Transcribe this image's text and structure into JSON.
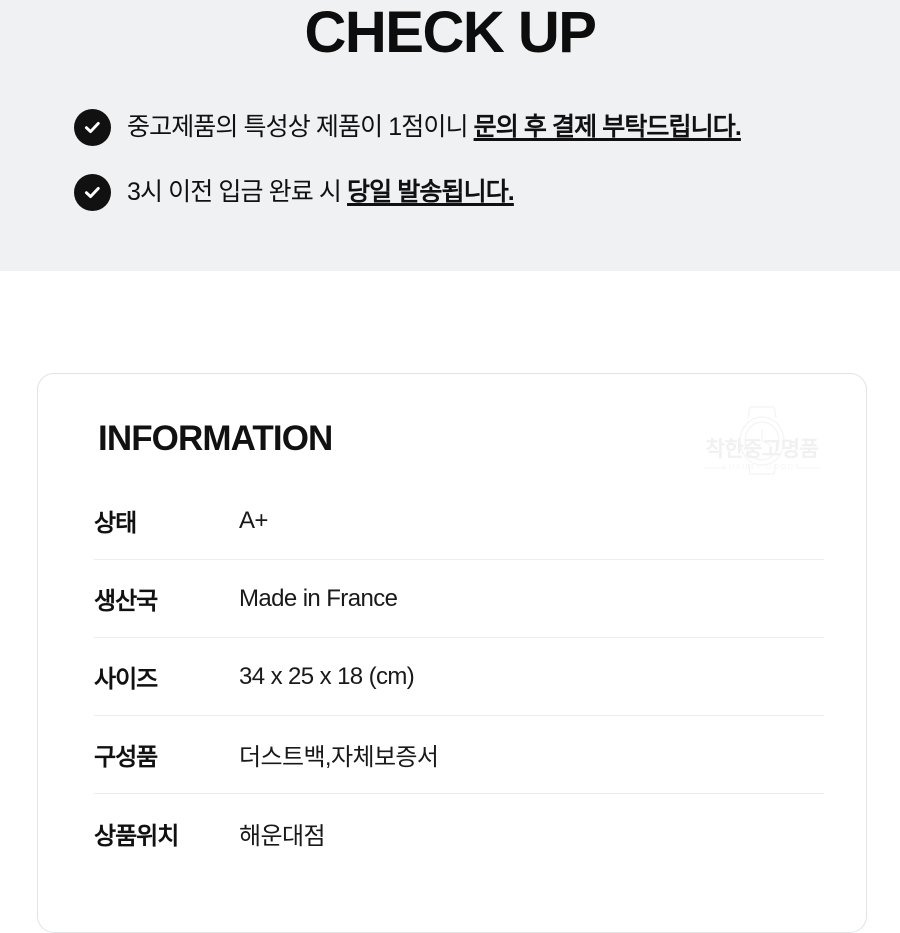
{
  "checkup": {
    "title": "CHECK UP",
    "items": [
      {
        "icon": "check-circle-icon",
        "plain": "중고제품의 특성상 제품이 1점이니 ",
        "emphasis": "문의 후 결제 부탁드립니다."
      },
      {
        "icon": "check-circle-icon",
        "plain": "3시 이전 입금 완료 시 ",
        "emphasis": "당일 발송됩니다."
      }
    ]
  },
  "info_card": {
    "heading": "INFORMATION",
    "watermark": {
      "icon": "watch-outline-icon",
      "brand": "착한중고명품",
      "tagline": "LUXURY GOODS"
    },
    "rows": [
      {
        "label": "상태",
        "value": "A+"
      },
      {
        "label": "생산국",
        "value": "Made in France"
      },
      {
        "label": "사이즈",
        "value": "34 x 25 x 18 (cm)"
      },
      {
        "label": "구성품",
        "value": "더스트백,자체보증서"
      },
      {
        "label": "상품위치",
        "value": "해운대점"
      }
    ]
  },
  "colors": {
    "panel_background": "#f0f1f3",
    "page_background": "#ffffff",
    "text": "#111111",
    "badge": "#111111",
    "divider": "#ededef",
    "card_border": "#e2e3e5"
  }
}
